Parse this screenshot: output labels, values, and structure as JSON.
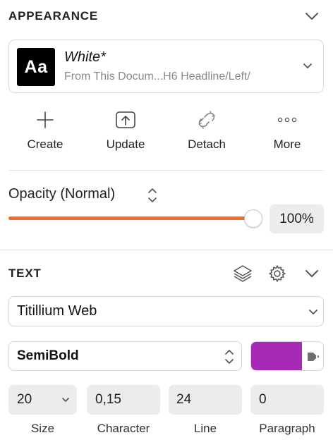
{
  "appearance": {
    "title": "APPEARANCE",
    "style": {
      "preview": "Aa",
      "name": "White*",
      "path": "From This Docum...H6 Headline/Left/"
    },
    "actions": [
      {
        "label": "Create",
        "icon": "plus-icon"
      },
      {
        "label": "Update",
        "icon": "upload-icon"
      },
      {
        "label": "Detach",
        "icon": "broken-link-icon"
      },
      {
        "label": "More",
        "icon": "more-icon"
      }
    ]
  },
  "opacity": {
    "label": "Opacity (Normal)",
    "value": "100%",
    "fraction": 1.0,
    "accent": "#f26b2c"
  },
  "text": {
    "title": "TEXT",
    "font_family": "Titillium Web",
    "font_weight": "SemiBold",
    "color": "#a62ab6",
    "fields": [
      {
        "value": "20",
        "label": "Size"
      },
      {
        "value": "0,15",
        "label": "Character"
      },
      {
        "value": "24",
        "label": "Line"
      },
      {
        "value": "0",
        "label": "Paragraph"
      }
    ]
  }
}
